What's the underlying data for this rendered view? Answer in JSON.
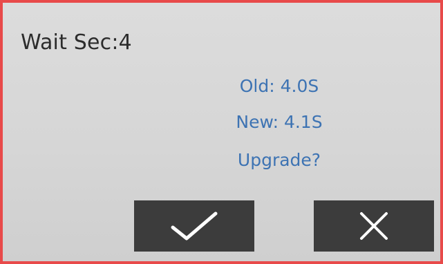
{
  "dialog": {
    "wait_label": "Wait Sec:4",
    "old_version": "Old: 4.0S",
    "new_version": "New: 4.1S",
    "question": "Upgrade?"
  },
  "buttons": {
    "confirm_icon": "check-icon",
    "cancel_icon": "close-icon"
  },
  "colors": {
    "border": "#e84a4a",
    "info_text": "#3d73b3",
    "button_bg": "#3c3c3c",
    "icon": "#ffffff"
  }
}
